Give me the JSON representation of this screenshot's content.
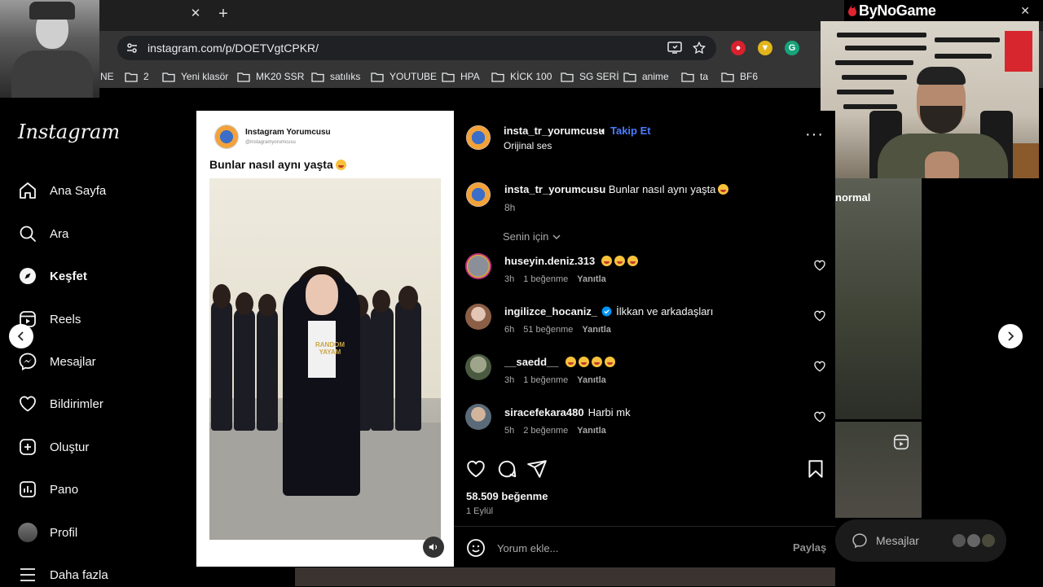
{
  "browser": {
    "url": "instagram.com/p/DOETVgtCPKR/",
    "bookmarks": [
      "NE",
      "2",
      "Yeni klasör",
      "MK20 SSR",
      "satılıks",
      "YOUTUBE",
      "HPA",
      "KİCK 100",
      "SG SERİ",
      "anime",
      "ta",
      "BF6"
    ]
  },
  "stream": {
    "logo_text": "ByNoGame"
  },
  "sidebar": {
    "logo": "Instagram",
    "items": [
      {
        "label": "Ana Sayfa",
        "icon": "home-icon"
      },
      {
        "label": "Ara",
        "icon": "search-icon"
      },
      {
        "label": "Keşfet",
        "icon": "compass-icon"
      },
      {
        "label": "Reels",
        "icon": "reels-icon"
      },
      {
        "label": "Mesajlar",
        "icon": "messenger-icon"
      },
      {
        "label": "Bildirimler",
        "icon": "heart-icon"
      },
      {
        "label": "Oluştur",
        "icon": "plus-square-icon"
      },
      {
        "label": "Pano",
        "icon": "chart-icon"
      },
      {
        "label": "Profil",
        "icon": "avatar-icon"
      },
      {
        "label": "Daha fazla",
        "icon": "menu-icon"
      }
    ]
  },
  "background": {
    "caption": "normal",
    "messages_label": "Mesajlar"
  },
  "media": {
    "card_name": "Instagram Yorumcusu",
    "card_handle": "@instagramyorumcusu",
    "card_text": "Bunlar nasıl aynı yaşta",
    "overlay_text": "RANDOM YAYAM"
  },
  "post": {
    "username": "insta_tr_yorumcusu",
    "separator": "•",
    "follow_label": "Takip Et",
    "audio": "Orijinal ses",
    "caption_user": "insta_tr_yorumcusu",
    "caption_text": "Bunlar nasıl aynı yaşta",
    "caption_time": "8h",
    "sort_label": "Senin için",
    "likes": "58.509 beğenme",
    "date": "1 Eylül",
    "comment_placeholder": "Yorum ekle...",
    "post_button": "Paylaş"
  },
  "comments": [
    {
      "user": "huseyin.deniz.313",
      "text": "",
      "emojis": 3,
      "time": "3h",
      "likes": "1 beğenme",
      "reply": "Yanıtla",
      "verified": false
    },
    {
      "user": "ingilizce_hocaniz_",
      "text": "İlkkan ve arkadaşları",
      "emojis": 0,
      "time": "6h",
      "likes": "51 beğenme",
      "reply": "Yanıtla",
      "verified": true
    },
    {
      "user": "__saedd__",
      "text": "",
      "emojis": 4,
      "time": "3h",
      "likes": "1 beğenme",
      "reply": "Yanıtla",
      "verified": false
    },
    {
      "user": "siracefekara480",
      "text": "Harbi mk",
      "emojis": 0,
      "time": "5h",
      "likes": "2 beğenme",
      "reply": "Yanıtla",
      "verified": false
    }
  ],
  "colors": {
    "accent": "#4a7dff",
    "background": "#000000",
    "panel": "#000000",
    "muted_text": "#a8a8a8"
  }
}
